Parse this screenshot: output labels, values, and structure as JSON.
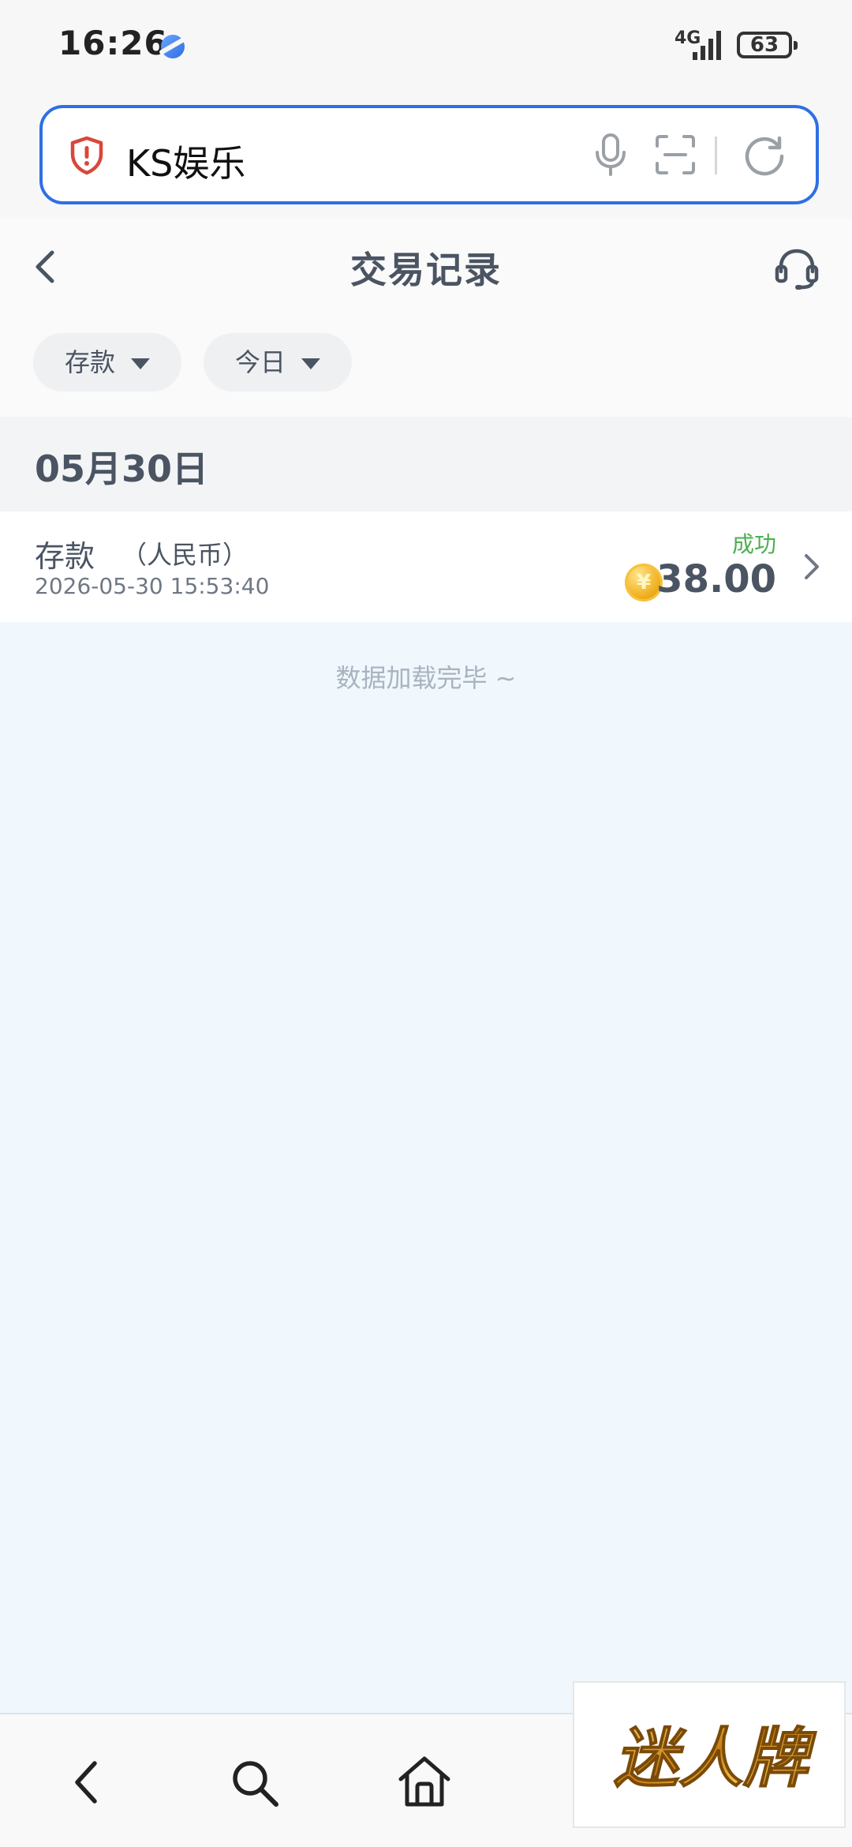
{
  "status_bar": {
    "time": "16:26",
    "network": "4G",
    "battery": "63"
  },
  "browser": {
    "url_text": "KS娱乐"
  },
  "header": {
    "title": "交易记录"
  },
  "filters": {
    "type_label": "存款",
    "date_label": "今日"
  },
  "section": {
    "date": "05月30日"
  },
  "transactions": [
    {
      "type": "存款",
      "currency": "（人民币）",
      "time": "2026-05-30 15:53:40",
      "status": "成功",
      "amount": "38.00",
      "coin_symbol": "¥"
    }
  ],
  "footer_note": "数据加载完毕 ~",
  "watermark": {
    "text": "迷人牌"
  },
  "colors": {
    "accent": "#2f6fe4",
    "success": "#4caf50",
    "text": "#4a5462",
    "page_bg": "#f0f7fd"
  }
}
